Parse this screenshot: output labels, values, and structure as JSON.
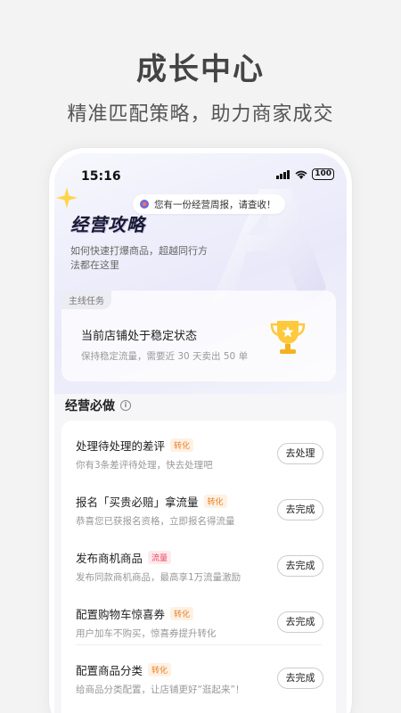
{
  "hero": {
    "title": "成长中心",
    "subtitle": "精准匹配策略，助力商家成交"
  },
  "status_bar": {
    "time": "15:16",
    "battery": "100"
  },
  "notice": {
    "text": "您有一份经营周报，请查收！"
  },
  "strategy": {
    "title": "经营攻略",
    "description": "如何快速打爆商品，超越同行方法都在这里"
  },
  "main_task": {
    "tag": "主线任务",
    "title": "当前店铺处于稳定状态",
    "description": "保持稳定流量，需要近 30 天卖出 50 单"
  },
  "section": {
    "title": "经营必做",
    "info_icon": "i"
  },
  "tasks": [
    {
      "title": "处理待处理的差评",
      "badge": "转化",
      "badge_type": "conv",
      "desc": "你有3条差评待处理，快去处理吧",
      "action": "去处理"
    },
    {
      "title": "报名「买贵必赔」拿流量",
      "badge": "转化",
      "badge_type": "conv",
      "desc": "恭喜您已获报名资格，立即报名得流量",
      "action": "去完成"
    },
    {
      "title": "发布商机商品",
      "badge": "流量",
      "badge_type": "flow",
      "desc": "发布同款商机商品，最高享1万流量激励",
      "action": "去完成"
    },
    {
      "title": "配置购物车惊喜券",
      "badge": "转化",
      "badge_type": "conv",
      "desc": "用户加车不购买，惊喜券提升转化",
      "action": "去完成"
    },
    {
      "title": "配置商品分类",
      "badge": "转化",
      "badge_type": "conv",
      "desc": "给商品分类配置，让店铺更好“逛起来”！",
      "action": "去完成"
    }
  ],
  "colors": {
    "badge_conversion": "#e8822a",
    "badge_traffic": "#e64a5f",
    "accent_purple": "#c8c6f5"
  }
}
